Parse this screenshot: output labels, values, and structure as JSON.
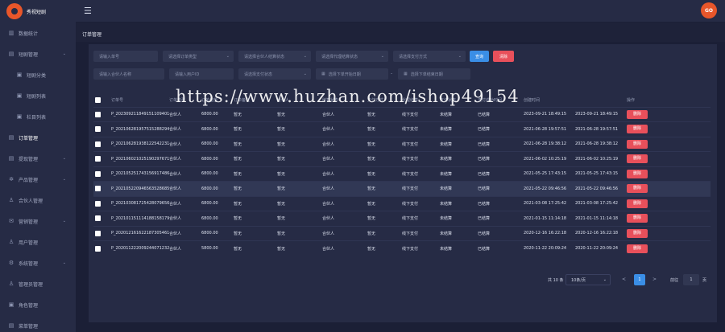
{
  "app": {
    "title": "秀视短剧",
    "avatar_text": "GO"
  },
  "sidebar": {
    "items": [
      {
        "label": "数据统计",
        "icon": "▥",
        "sub": false,
        "arrow": false,
        "active": false
      },
      {
        "label": "短剧管理",
        "icon": "▤",
        "sub": false,
        "arrow": true,
        "active": false
      },
      {
        "label": "短剧分类",
        "icon": "▣",
        "sub": true,
        "arrow": false,
        "active": false
      },
      {
        "label": "短剧列表",
        "icon": "▣",
        "sub": true,
        "arrow": false,
        "active": false
      },
      {
        "label": "栏目列表",
        "icon": "▣",
        "sub": true,
        "arrow": false,
        "active": false
      },
      {
        "label": "订单管理",
        "icon": "▤",
        "sub": false,
        "arrow": false,
        "active": true
      },
      {
        "label": "提现管理",
        "icon": "▤",
        "sub": false,
        "arrow": true,
        "active": false
      },
      {
        "label": "产品管理",
        "icon": "✲",
        "sub": false,
        "arrow": true,
        "active": false
      },
      {
        "label": "合伙人管理",
        "icon": "♙",
        "sub": false,
        "arrow": false,
        "active": false
      },
      {
        "label": "营销管理",
        "icon": "✉",
        "sub": false,
        "arrow": true,
        "active": false
      },
      {
        "label": "用户管理",
        "icon": "♙",
        "sub": false,
        "arrow": false,
        "active": false
      },
      {
        "label": "系统管理",
        "icon": "⚙",
        "sub": false,
        "arrow": true,
        "active": false
      },
      {
        "label": "管理员管理",
        "icon": "♙",
        "sub": false,
        "arrow": false,
        "active": false
      },
      {
        "label": "角色管理",
        "icon": "▣",
        "sub": false,
        "arrow": false,
        "active": false
      },
      {
        "label": "菜单管理",
        "icon": "▤",
        "sub": false,
        "arrow": false,
        "active": false
      }
    ]
  },
  "page": {
    "title": "订单管理"
  },
  "filters": {
    "order_no": "请输入单号",
    "order_type": "请选择订单类型",
    "partner_settle": "请选择合伙人结算状态",
    "agent_settle": "请选择代理结算状态",
    "pay_method": "请选择支付方式",
    "search_label": "查询",
    "clear_label": "清除",
    "partner_name": "请输入合伙人名称",
    "user_id": "请输入用户ID",
    "pay_status": "请选择支付状态",
    "start_date": "选择下单开始日期",
    "date_sep": "-",
    "end_date": "选择下单结束日期"
  },
  "table": {
    "headers": [
      "订单号",
      "订单类型",
      "订单金额",
      "订单备注",
      "合伙人",
      "结算状态",
      "支付方式",
      "代理结算",
      "支付状态",
      "支付成功时间",
      "创建时间",
      "操作"
    ],
    "rows": [
      [
        "P_20230921184915110940104",
        "合伙人",
        "6800.00",
        "暂无",
        "暂无",
        "合伙人",
        "暂无",
        "线下支付",
        "未结算",
        "已结算",
        "2023-09-21 18:49:15",
        "2023-09-21 18:49:15"
      ],
      [
        "P_20210628195751528829465",
        "合伙人",
        "6800.00",
        "暂无",
        "暂无",
        "合伙人",
        "暂无",
        "线下支付",
        "未结算",
        "已结算",
        "2021-06-28 19:57:51",
        "2021-06-28 19:57:51"
      ],
      [
        "P_20210628193812254223106",
        "合伙人",
        "6800.00",
        "暂无",
        "暂无",
        "合伙人",
        "暂无",
        "线下支付",
        "未结算",
        "已结算",
        "2021-06-28 19:38:12",
        "2021-06-28 19:38:12"
      ],
      [
        "P_20210602102519029767162",
        "合伙人",
        "6800.00",
        "暂无",
        "暂无",
        "合伙人",
        "暂无",
        "线下支付",
        "未结算",
        "已结算",
        "2021-06-02 10:25:19",
        "2021-06-02 10:25:19"
      ],
      [
        "P_20210525174315691748623",
        "合伙人",
        "6800.00",
        "暂无",
        "暂无",
        "合伙人",
        "暂无",
        "线下支付",
        "未结算",
        "已结算",
        "2021-05-25 17:43:15",
        "2021-05-25 17:43:15"
      ],
      [
        "P_20210522094656352868521",
        "合伙人",
        "6800.00",
        "暂无",
        "暂无",
        "合伙人",
        "暂无",
        "线下支付",
        "未结算",
        "已结算",
        "2021-05-22 09:46:56",
        "2021-05-22 09:46:56"
      ],
      [
        "P_20210308172542807965677",
        "合伙人",
        "6800.00",
        "暂无",
        "暂无",
        "合伙人",
        "暂无",
        "线下支付",
        "未结算",
        "已结算",
        "2021-03-08 17:25:42",
        "2021-03-08 17:25:42"
      ],
      [
        "P_20210115111418815817901",
        "合伙人",
        "6800.00",
        "暂无",
        "暂无",
        "合伙人",
        "暂无",
        "线下支付",
        "未结算",
        "已结算",
        "2021-01-15 11:14:18",
        "2021-01-15 11:14:18"
      ],
      [
        "P_20201216162218730546167",
        "合伙人",
        "6800.00",
        "暂无",
        "暂无",
        "合伙人",
        "暂无",
        "线下支付",
        "未结算",
        "已结算",
        "2020-12-16 16:22:18",
        "2020-12-16 16:22:18"
      ],
      [
        "P_20201122200924407123267",
        "合伙人",
        "5800.00",
        "暂无",
        "暂无",
        "合伙人",
        "暂无",
        "线下支付",
        "未结算",
        "已结算",
        "2020-11-22 20:09:24",
        "2020-11-22 20:09:24"
      ]
    ],
    "highlight_row": 5,
    "action_label": "删除"
  },
  "pagination": {
    "total": "共 10 条",
    "page_size": "10条/页",
    "prev": "<",
    "current": "1",
    "next": ">",
    "goto": "前往",
    "goto_value": "1",
    "unit": "页"
  },
  "watermark": "https://www.huzhan.com/ishop49154"
}
